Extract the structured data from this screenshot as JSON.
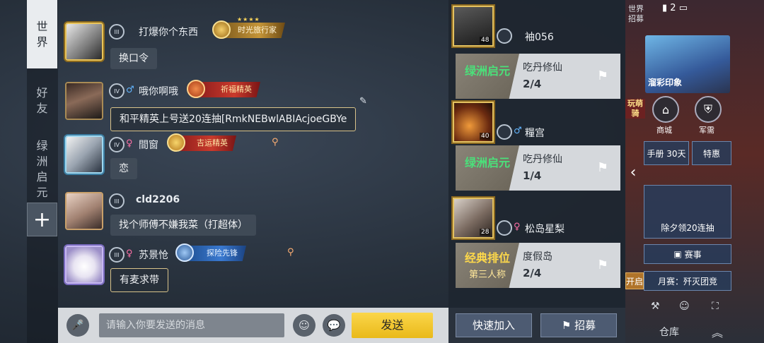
{
  "tabs": {
    "world": "世界",
    "friends": "好友",
    "oasis": "绿洲启元",
    "add": "+"
  },
  "messages": [
    {
      "name": "打爆你个东西",
      "rank": "III",
      "gender": "",
      "title": "时光旅行家",
      "text": "换口令"
    },
    {
      "name": "哦你啊哦",
      "rank": "IV",
      "gender": "♂",
      "title": "祈福精英",
      "text": "和平精英上号送20连抽[RmkNEBwlABIAcjoeGBYe"
    },
    {
      "name": "間窗",
      "rank": "IV",
      "gender": "♀",
      "title": "吉运精英",
      "text": "恋"
    },
    {
      "name": "cld2206",
      "rank": "III",
      "gender": "",
      "title": "",
      "text": "找个师傅不嫌我菜（打超体）"
    },
    {
      "name": "苏景怆",
      "rank": "III",
      "gender": "♀",
      "title": "探险先锋",
      "text": "有麦求带"
    }
  ],
  "input": {
    "placeholder": "请输入你要发送的消息",
    "send": "发送"
  },
  "recruit": {
    "entries": [
      {
        "name": "袖056",
        "level": "48",
        "gender": "",
        "mode": "绿洲启元",
        "mode_sub": "",
        "map": "吃丹修仙",
        "count": "2/4"
      },
      {
        "name": "糧宫",
        "level": "40",
        "gender": "♂",
        "mode": "绿洲启元",
        "mode_sub": "",
        "map": "吃丹修仙",
        "count": "1/4"
      },
      {
        "name": "松岛星梨",
        "level": "28",
        "gender": "♀",
        "mode": "经典排位",
        "mode_sub": "第三人称",
        "map": "度假岛",
        "count": "2/4"
      }
    ],
    "quick_join": "快速加入",
    "recruit_btn": "招募"
  },
  "strip": {
    "side_tab": "世界招募",
    "status_count": "2",
    "promo_label": "溜彩印象",
    "side_promo": "玩萌骑",
    "shop": "商城",
    "armory": "军需",
    "handbook": "手册",
    "handbook_days": "30天",
    "special": "特惠",
    "promo2": "除夕领20连抽",
    "events": "赛事",
    "open": "开启",
    "monthly": "月赛：歼灭团竞",
    "warehouse": "仓库"
  }
}
